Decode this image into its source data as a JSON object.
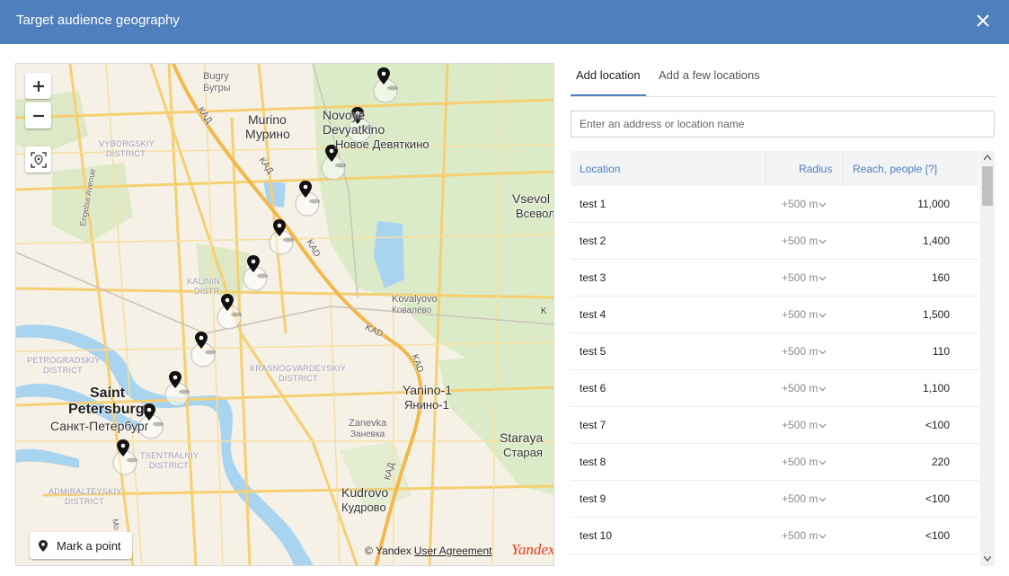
{
  "dialog": {
    "title": "Target audience geography",
    "close_icon": "close-icon"
  },
  "map": {
    "mark_point_label": "Mark a point",
    "copyright": "© Yandex",
    "user_agreement": "User Agreement",
    "logo": "Yandex",
    "labels": {
      "bugry": "Bugry",
      "bugry_ru": "Бугры",
      "murino": "Murino",
      "murino_ru": "Мурино",
      "novoye": "Novoye",
      "devyatkino": "Devyatkino",
      "devyatkino_ru": "Новое Девяткино",
      "vsevol": "Vsevol",
      "vsevol_ru": "Всевол",
      "vyborgskiy": "VYBORGSKIY",
      "vyborgskiy2": "DISTRICT",
      "engelsa": "Engelsa Avenue",
      "kalinin": "KALININ",
      "kalinin2": "DISTR",
      "kovalyovo": "Kovalyovo",
      "kovalyovo_ru": "Ковалёво",
      "petrogradskiy": "PETROGRADSKIY",
      "petrogradskiy2": "DISTRICT",
      "krasnogvard": "KRASNOGVARDEYSKIY",
      "krasnogvard2": "DISTRICT",
      "saint": "Saint",
      "petersburg": "Petersburg",
      "spb_ru": "Санкт-Петербург",
      "yanino": "Yanino-1",
      "yanino_ru": "Янино-1",
      "zanevka": "Zanevka",
      "zanevka_ru": "Заневка",
      "staraya": "Staraya",
      "staraya_ru": "Старая",
      "tsentralniy": "TSENTRALNIY",
      "tsentralniy2": "DISTRICT",
      "admiralteyskiy": "ADMIRALTEYSKIY",
      "admiralteyskiy2": "DISTRICT",
      "kudrovo": "Kudrovo",
      "kudrovo_ru": "Кудрово",
      "kad": "КАД",
      "kad_en": "KAD",
      "mo": "Mo"
    }
  },
  "tabs": [
    {
      "label": "Add location"
    },
    {
      "label": "Add a few locations"
    }
  ],
  "search": {
    "placeholder": "Enter an address or location name",
    "value": ""
  },
  "table": {
    "columns": {
      "location": "Location",
      "radius": "Radius",
      "reach": "Reach, people [?]"
    },
    "rows": [
      {
        "location": "test 1",
        "radius": "+500 m",
        "reach": "11,000"
      },
      {
        "location": "test 2",
        "radius": "+500 m",
        "reach": "1,400"
      },
      {
        "location": "test 3",
        "radius": "+500 m",
        "reach": "160"
      },
      {
        "location": "test 4",
        "radius": "+500 m",
        "reach": "1,500"
      },
      {
        "location": "test 5",
        "radius": "+500 m",
        "reach": "110"
      },
      {
        "location": "test 6",
        "radius": "+500 m",
        "reach": "1,100"
      },
      {
        "location": "test 7",
        "radius": "+500 m",
        "reach": "<100"
      },
      {
        "location": "test 8",
        "radius": "+500 m",
        "reach": "220"
      },
      {
        "location": "test 9",
        "radius": "+500 m",
        "reach": "<100"
      },
      {
        "location": "test 10",
        "radius": "+500 m",
        "reach": "<100"
      }
    ]
  }
}
